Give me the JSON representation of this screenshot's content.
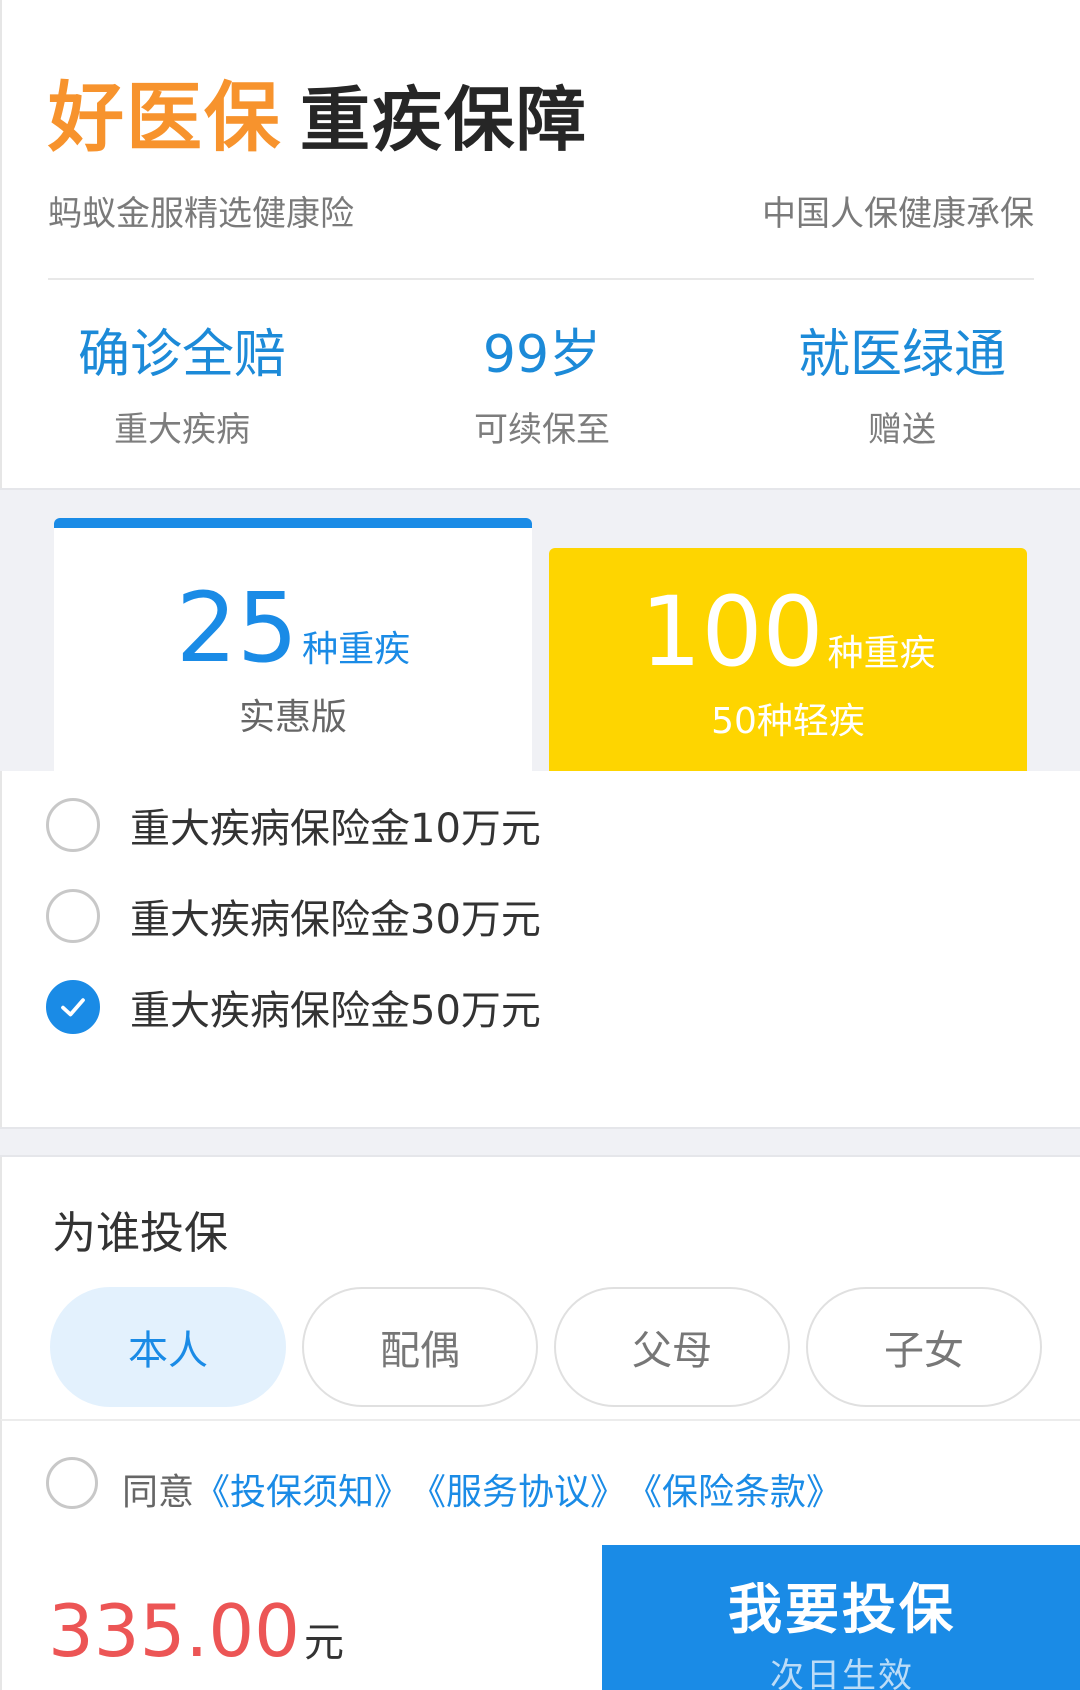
{
  "header": {
    "brand": "好医保",
    "product": "重疾保障",
    "subtitle_left": "蚂蚁金服精选健康险",
    "subtitle_right": "中国人保健康承保"
  },
  "features": [
    {
      "big": "确诊全赔",
      "small": "重大疾病"
    },
    {
      "big": "99岁",
      "small": "可续保至"
    },
    {
      "big": "就医绿通",
      "small": "赠送"
    }
  ],
  "plans": {
    "basic": {
      "number": "25",
      "unit": "种重疾",
      "sub": "实惠版",
      "selected": true
    },
    "premium": {
      "number": "100",
      "unit": "种重疾",
      "sub": "50种轻疾",
      "selected": false
    }
  },
  "coverage_options": [
    {
      "label": "重大疾病保险金10万元",
      "checked": false
    },
    {
      "label": "重大疾病保险金30万元",
      "checked": false
    },
    {
      "label": "重大疾病保险金50万元",
      "checked": true
    }
  ],
  "insured": {
    "title": "为谁投保",
    "relations": [
      "本人",
      "配偶",
      "父母",
      "子女"
    ],
    "selected": "本人"
  },
  "agreement": {
    "prefix": "同意",
    "links": [
      "《投保须知》",
      "《服务协议》",
      "《保险条款》"
    ],
    "checked": false
  },
  "footer": {
    "price": "335.00",
    "price_unit": "元",
    "buy_label": "我要投保",
    "buy_sub": "次日生效"
  },
  "colors": {
    "brand_orange": "#f7932d",
    "primary_blue": "#1a8be6",
    "premium_yellow": "#fed500",
    "price_red": "#ec5555"
  }
}
